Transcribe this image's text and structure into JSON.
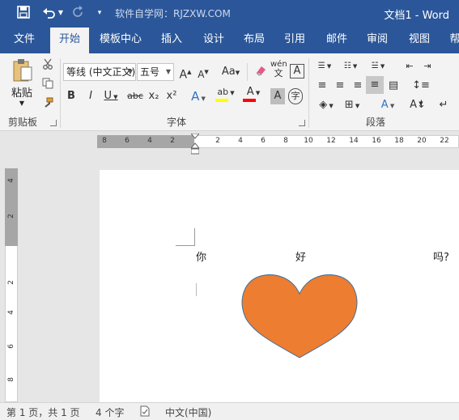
{
  "titlebar": {
    "save_icon": "save-icon",
    "undo_icon": "undo-icon",
    "redo_icon": "redo-icon",
    "customize_icon": "customize-quick-access-icon",
    "site_text": "软件自学网：RJZXW.COM",
    "document_title": "文档1 - Word"
  },
  "tabs": [
    {
      "label": "文件"
    },
    {
      "label": "开始",
      "active": true
    },
    {
      "label": "模板中心"
    },
    {
      "label": "插入"
    },
    {
      "label": "设计"
    },
    {
      "label": "布局"
    },
    {
      "label": "引用"
    },
    {
      "label": "邮件"
    },
    {
      "label": "审阅"
    },
    {
      "label": "视图"
    },
    {
      "label": "帮"
    }
  ],
  "clipboard": {
    "paste_label": "粘贴",
    "group_label": "剪贴板"
  },
  "font": {
    "font_name": "等线 (中文正文)",
    "font_size": "五号",
    "grow_label": "A",
    "shrink_label": "A",
    "case_label": "Aa",
    "phonetic_label": "wén",
    "phonetic_sub": "文",
    "border_label": "A",
    "bold": "B",
    "italic": "I",
    "underline": "U",
    "strike": "abc",
    "subscript": "x₂",
    "superscript": "x²",
    "effects": "A",
    "highlight": "ab",
    "color": "A",
    "shading": "A",
    "enclose": "字",
    "group_label": "字体"
  },
  "paragraph": {
    "group_label": "段落"
  },
  "ruler": {
    "left_marks": [
      "8",
      "6",
      "4",
      "2"
    ],
    "right_marks": [
      "2",
      "4",
      "6",
      "8",
      "10",
      "12",
      "14",
      "16",
      "18",
      "20",
      "22"
    ],
    "vertical_marks": [
      "4",
      "2",
      "2",
      "4",
      "6",
      "8"
    ],
    "tab_selector": "L"
  },
  "document": {
    "words": [
      "你",
      "好",
      "吗?"
    ],
    "shape": {
      "type": "heart",
      "fill": "#ed7d31",
      "stroke": "#41719c"
    }
  },
  "status": {
    "page_info": "第 1 页，共 1 页",
    "word_count": "4 个字",
    "language": "中文(中国)",
    "proof_icon": "proofing-icon"
  },
  "colors": {
    "accent": "#2b579a",
    "highlight_bar": "#ffff00",
    "font_color_bar": "#ff0000"
  }
}
